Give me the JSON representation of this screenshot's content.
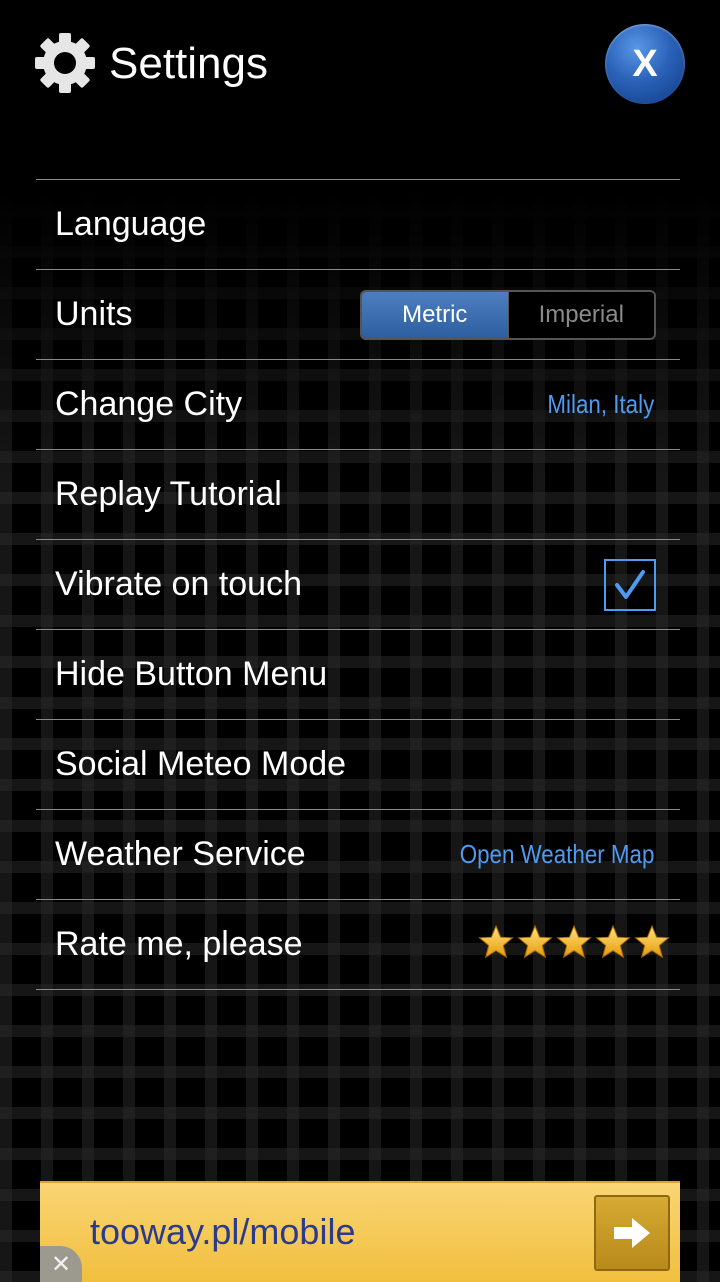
{
  "header": {
    "title": "Settings",
    "close_label": "X"
  },
  "settings": {
    "language": {
      "label": "Language"
    },
    "units": {
      "label": "Units",
      "options": [
        "Metric",
        "Imperial"
      ],
      "selected": "Metric"
    },
    "city": {
      "label": "Change City",
      "value": "Milan, Italy"
    },
    "tutorial": {
      "label": "Replay Tutorial"
    },
    "vibrate": {
      "label": "Vibrate on touch",
      "checked": true
    },
    "hide_menu": {
      "label": "Hide Button Menu"
    },
    "social": {
      "label": "Social Meteo Mode"
    },
    "weather_service": {
      "label": "Weather Service",
      "value": "Open Weather Map"
    },
    "rate": {
      "label": "Rate me, please",
      "stars": 5
    }
  },
  "ad": {
    "text": "tooway.pl/mobile",
    "close_symbol": "✕"
  },
  "colors": {
    "accent_blue": "#4f9bf0",
    "ad_yellow": "#f5c94f",
    "star_gold": "#f5b21c"
  }
}
